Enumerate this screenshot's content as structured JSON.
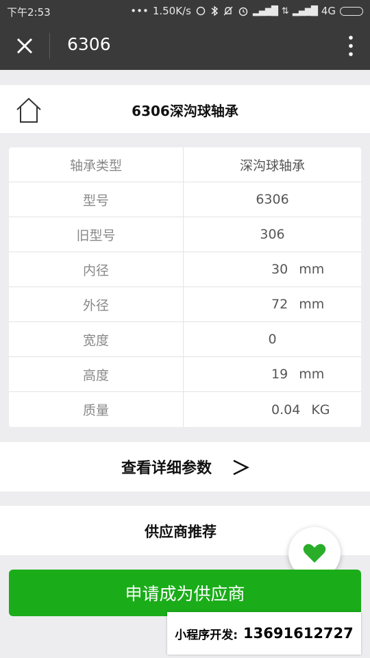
{
  "status_bar": {
    "time": "下午2:53",
    "dots": "•••",
    "speed": "1.50K/s",
    "network": "4G"
  },
  "title_bar": {
    "title": "6306"
  },
  "header": {
    "title": "6306深沟球轴承"
  },
  "specs": [
    {
      "label": "轴承类型",
      "value": "深沟球轴承",
      "unit": ""
    },
    {
      "label": "型号",
      "value": "6306",
      "unit": ""
    },
    {
      "label": "旧型号",
      "value": "306",
      "unit": ""
    },
    {
      "label": "内径",
      "value": "30",
      "unit": "mm"
    },
    {
      "label": "外径",
      "value": "72",
      "unit": "mm"
    },
    {
      "label": "宽度",
      "value": "0",
      "unit": ""
    },
    {
      "label": "高度",
      "value": "19",
      "unit": "mm"
    },
    {
      "label": "质量",
      "value": "0.04",
      "unit": "KG"
    }
  ],
  "detail_link": {
    "label": "查看详细参数"
  },
  "supplier_section": {
    "title": "供应商推荐"
  },
  "apply_button": {
    "label": "申请成为供应商"
  },
  "watermark": {
    "label": "小程序开发:",
    "phone": "13691612727"
  },
  "colors": {
    "accent_green": "#1aad19",
    "heart_green": "#2aae2a",
    "bar_dark": "#3a3a3a",
    "page_bg": "#ededf0"
  },
  "icons": [
    "close-icon",
    "more-vertical-icon",
    "home-icon",
    "chevron-right-icon",
    "heart-icon",
    "bluetooth-icon",
    "alarm-icon",
    "battery-icon"
  ]
}
